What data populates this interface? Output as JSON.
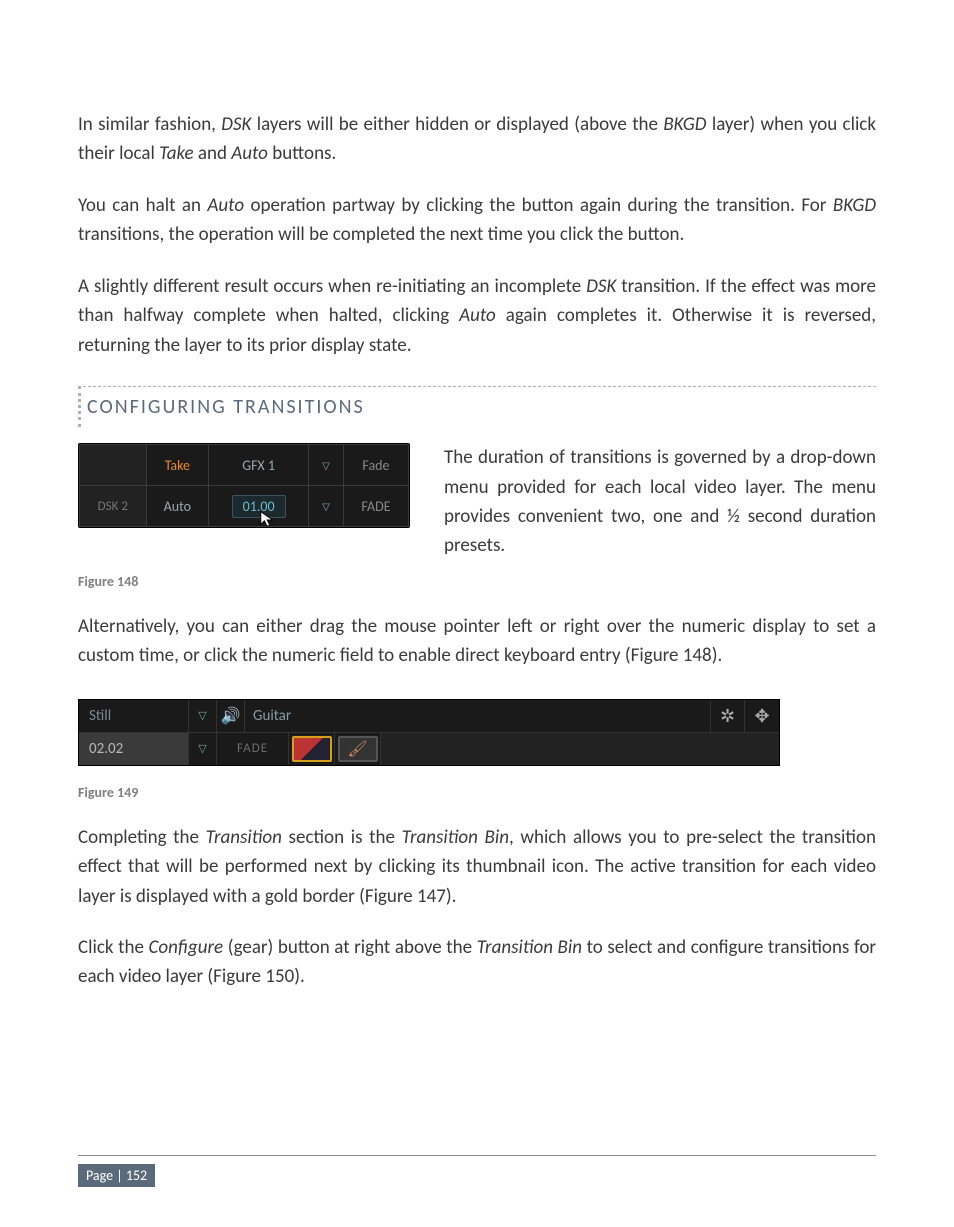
{
  "paragraphs": {
    "p1_a": "In similar fashion, ",
    "p1_b": " layers will be either hidden or displayed (above the ",
    "p1_c": " layer) when you click their local ",
    "p1_d": " and ",
    "p1_e": " buttons.",
    "p2_a": "You can halt an ",
    "p2_b": " operation partway by clicking the button again during the transition. For ",
    "p2_c": " transitions, the operation will be completed the next time you click the button.",
    "p3_a": "A slightly different result occurs when re-initiating an incomplete ",
    "p3_b": " transition. If the effect was more than halfway complete when halted, clicking ",
    "p3_c": " again completes it. Otherwise it is reversed, returning the layer to its prior display state.",
    "p4": "The duration of transitions is governed by a drop-down menu provided for each local video layer. The menu provides convenient two, one and ½ second duration presets.",
    "p5": "Alternatively, you can either drag the mouse pointer left or right over the numeric display to set a custom time, or click the numeric field to enable direct keyboard entry (Figure 148).",
    "p6_a": "Completing the ",
    "p6_b": " section is the ",
    "p6_c": ", which allows you to pre-select the transition effect that will be performed next by clicking its thumbnail icon.  The active transition for each video layer is displayed with a gold border (Figure 147).",
    "p7_a": "Click the ",
    "p7_b": " (gear) button at right above the ",
    "p7_c": " to select and configure transitions for each video layer (Figure 150)."
  },
  "italics": {
    "dsk": "DSK",
    "bkgd": "BKGD",
    "take": "Take",
    "auto": "Auto",
    "transition": "Transition",
    "transition_bin": "Transition Bin",
    "configure": "Configure"
  },
  "section_heading": "CONFIGURING TRANSITIONS",
  "figure148": {
    "caption": "Figure 148",
    "row1": {
      "take": "Take",
      "gfx": "GFX 1",
      "drop": "▽",
      "fade": "Fade"
    },
    "row2": {
      "label": "DSK 2",
      "auto": "Auto",
      "num": "01.00",
      "drop": "▽",
      "fade": "FADE"
    }
  },
  "figure149": {
    "caption": "Figure 149",
    "row1": {
      "label": "Still",
      "drop": "▽",
      "audio_icon": "🔊",
      "title": "Guitar",
      "gear": "✲",
      "move": "✥"
    },
    "row2": {
      "num": "02.02",
      "drop": "▽",
      "fade": "FADE",
      "brush": "🖌"
    }
  },
  "footer": {
    "page_label": "Page | 152"
  }
}
